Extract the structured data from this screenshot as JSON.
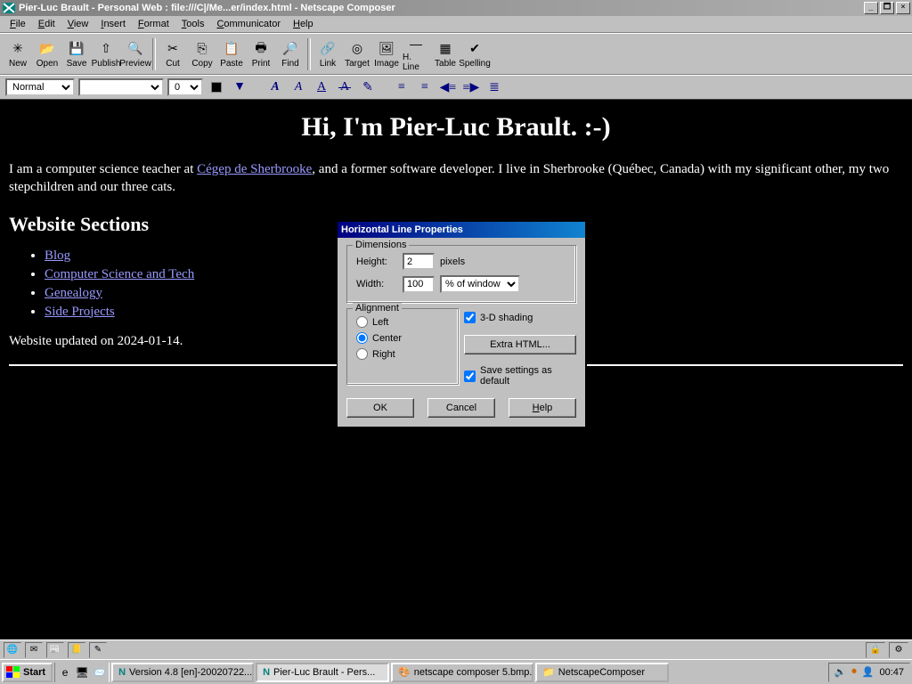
{
  "titlebar": {
    "text": "Pier-Luc Brault - Personal Web : file:///C|/Me...er/index.html - Netscape Composer"
  },
  "menu": [
    "File",
    "Edit",
    "View",
    "Insert",
    "Format",
    "Tools",
    "Communicator",
    "Help"
  ],
  "toolbar": [
    {
      "label": "New",
      "icon": "✳"
    },
    {
      "label": "Open",
      "icon": "📂"
    },
    {
      "label": "Save",
      "icon": "💾"
    },
    {
      "label": "Publish",
      "icon": "⇧"
    },
    {
      "label": "Preview",
      "icon": "🔍"
    },
    {
      "sep": true
    },
    {
      "label": "Cut",
      "icon": "✂"
    },
    {
      "label": "Copy",
      "icon": "⎘"
    },
    {
      "label": "Paste",
      "icon": "📋"
    },
    {
      "label": "Print",
      "icon": "🖶"
    },
    {
      "label": "Find",
      "icon": "🔎"
    },
    {
      "sep": true
    },
    {
      "label": "Link",
      "icon": "🔗"
    },
    {
      "label": "Target",
      "icon": "◎"
    },
    {
      "label": "Image",
      "icon": "🖼"
    },
    {
      "label": "H. Line",
      "icon": "—"
    },
    {
      "label": "Table",
      "icon": "▦"
    },
    {
      "label": "Spelling",
      "icon": "✔"
    }
  ],
  "fmt": {
    "style": "Normal",
    "font": "",
    "size": "0"
  },
  "page": {
    "h1": "Hi, I'm Pier-Luc Brault. :-)",
    "p1a": "I am a computer science teacher at ",
    "p1link": "Cégep de Sherbrooke",
    "p1b": ", and a former software developer. I live in Sherbrooke (Québec, Canada) with my significant other, my two stepchildren and our three cats.",
    "h2": "Website Sections",
    "links": [
      "Blog",
      "Computer Science and Tech",
      "Genealogy",
      "Side Projects"
    ],
    "updated": "Website updated on 2024-01-14."
  },
  "dialog": {
    "title": "Horizontal Line Properties",
    "dimensions_legend": "Dimensions",
    "height_label": "Height:",
    "height_val": "2",
    "height_unit": "pixels",
    "width_label": "Width:",
    "width_val": "100",
    "width_unit": "% of window",
    "alignment_legend": "Alignment",
    "align": [
      "Left",
      "Center",
      "Right"
    ],
    "align_sel": "Center",
    "shading": "3-D shading",
    "extra": "Extra HTML...",
    "save_default": "Save settings as default",
    "ok": "OK",
    "cancel": "Cancel",
    "help": "Help"
  },
  "taskbar": {
    "start": "Start",
    "tasks": [
      {
        "label": "Version 4.8 [en]-20020722...",
        "icon": "N"
      },
      {
        "label": "Pier-Luc Brault - Pers...",
        "icon": "N",
        "active": true
      },
      {
        "label": "netscape composer 5.bmp...",
        "icon": "🎨"
      },
      {
        "label": "NetscapeComposer",
        "icon": "📁"
      }
    ],
    "clock": "00:47"
  }
}
